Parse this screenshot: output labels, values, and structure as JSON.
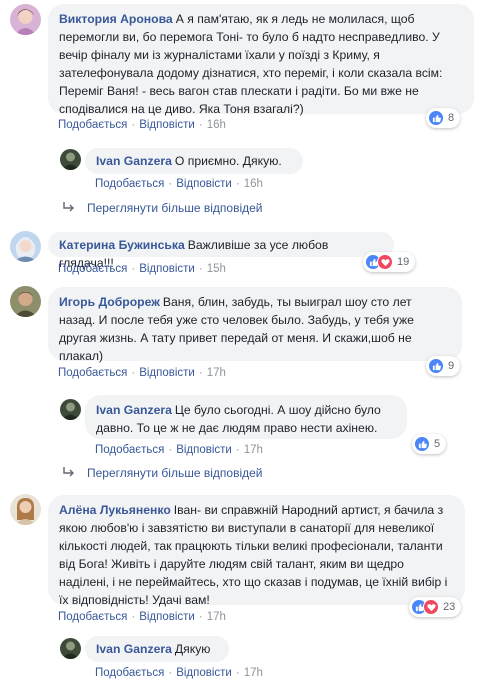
{
  "actions": {
    "like_label": "Подобається",
    "reply_label": "Відповісти",
    "view_more_replies": "Переглянути більше відповідей"
  },
  "comments": [
    {
      "author": "Виктория Аронова",
      "text": "А я пам'ятаю, як я ледь не молилася, щоб перемогли ви, бо перемога Тоні- то було б надто несправедливо. У вечір фіналу ми із журналістами їхали у поїзді з Криму, я зателефонувала додому дізнатися, хто переміг, і коли сказала всім: Переміг Ваня! - весь вагон став плескати і радіти. Бо ми вже не сподівалися на це диво. Яка Тоня взагалі?)",
      "time": "16h",
      "reaction_count": "8"
    },
    {
      "author": "Ivan Ganzera",
      "text": "О приємно. Дякую.",
      "time": "16h",
      "reaction_count": ""
    },
    {
      "author": "Катерина Бужинська",
      "text": "Важливіше за усе любов глядача!!!",
      "time": "15h",
      "reaction_count": "19"
    },
    {
      "author": "Игорь Доброреж",
      "text": "Ваня, блин, забудь, ты выиграл шоу сто лет назад. И после тебя уже сто человек было. Забудь, у тебя уже другая жизнь. А тату привет передай от меня. И скажи,шоб не плакал)",
      "time": "17h",
      "reaction_count": "9"
    },
    {
      "author": "Ivan Ganzera",
      "text": "Це було сьогодні. А шоу дійсно було давно. То це ж не дає людям право нести ахінею.",
      "time": "17h",
      "reaction_count": "5"
    },
    {
      "author": "Алёна Лукьяненко",
      "text": "Іван- ви справжній Народний артист, я бачила з якою любов'ю і завзятістю ви виступали в санаторії для невеликої кількості людей, так працюють тільки великі професіонали, таланти від Бога! Живіть і даруйте людям свій талант, яким ви щедро наділені, і не переймайтесь, хто що сказав і подумав, це їхній вибір і їх відповідність! Удачі вам!",
      "time": "17h",
      "reaction_count": "23"
    },
    {
      "author": "Ivan Ganzera",
      "text": "Дякую",
      "time": "17h",
      "reaction_count": ""
    }
  ],
  "icons": {
    "reply_arrow": "reply-arrow-icon",
    "like": "like-reaction-icon",
    "love": "love-reaction-icon"
  },
  "colors": {
    "link": "#385898",
    "bubble": "#f2f3f5",
    "like": "#4a86f7",
    "love": "#f0485f"
  }
}
